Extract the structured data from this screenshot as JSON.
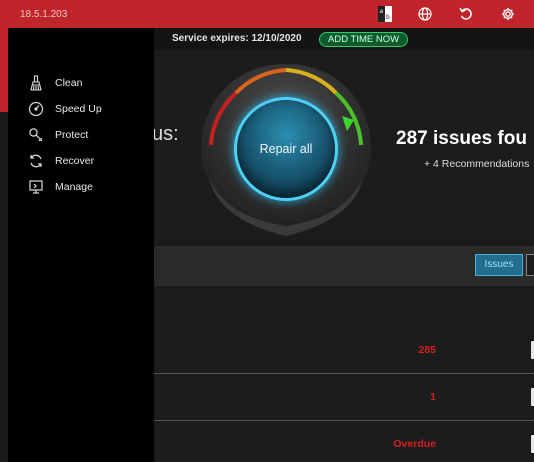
{
  "app": {
    "version": "18.5.1.203",
    "toolbar_icons": [
      "translate-icon",
      "globe-icon",
      "undo-icon",
      "gear-icon"
    ],
    "accent_color": "#c0252b"
  },
  "sidebar": {
    "items": [
      {
        "label": "Clean",
        "icon": "broom-icon"
      },
      {
        "label": "Speed Up",
        "icon": "speedometer-icon"
      },
      {
        "label": "Protect",
        "icon": "wrench-icon"
      },
      {
        "label": "Recover",
        "icon": "refresh-icon"
      },
      {
        "label": "Manage",
        "icon": "monitor-icon"
      }
    ]
  },
  "service": {
    "expires_text": "Service expires:  12/10/2020",
    "add_time_label": "ADD TIME NOW"
  },
  "status": {
    "label_fragment": "us:",
    "issues_title": "287 issues fou",
    "recommendations": "+ 4 Recommendations",
    "repair_label": "Repair all"
  },
  "tabs": {
    "issues_label": "Issues"
  },
  "rows": [
    {
      "value": "285"
    },
    {
      "value": "1"
    },
    {
      "value": "Overdue"
    }
  ]
}
